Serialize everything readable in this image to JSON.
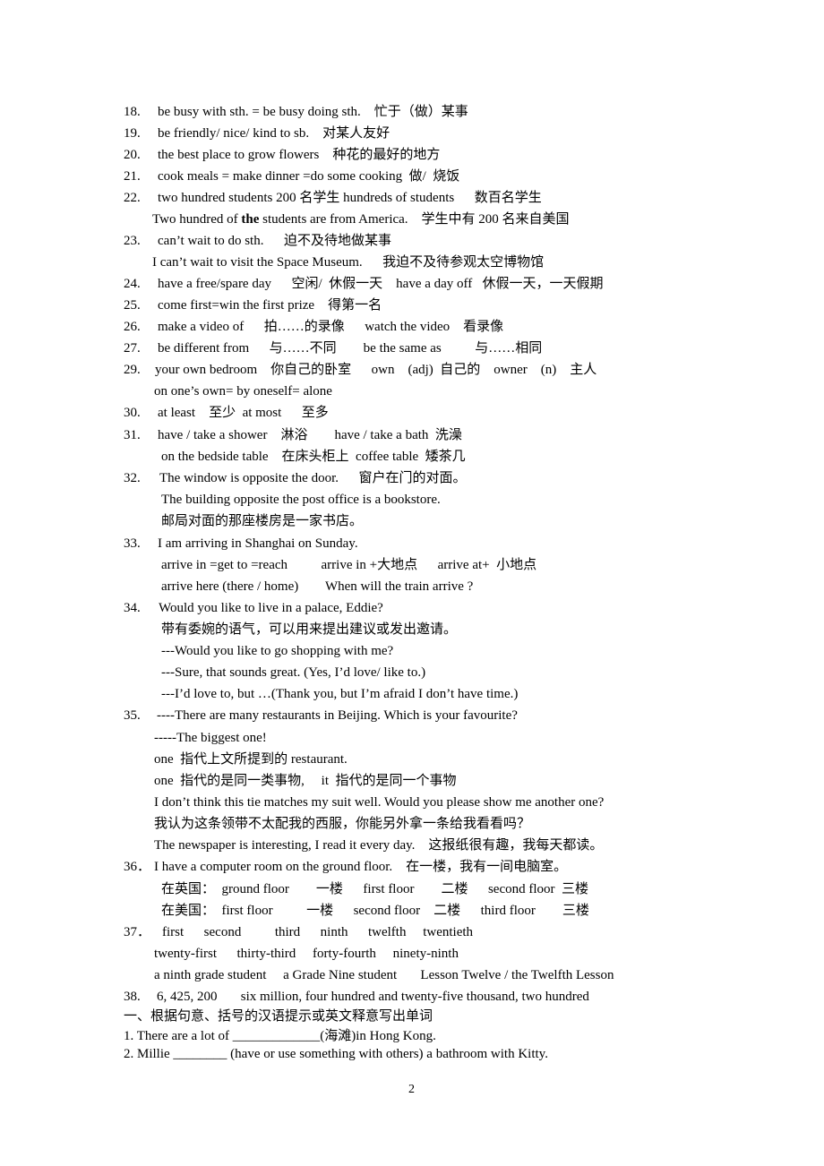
{
  "lines": [
    {
      "num": "18.",
      "text": "be busy with sth. = be busy doing sth.    忙于（做）某事"
    },
    {
      "num": "19.",
      "text": "be friendly/ nice/ kind to sb.    对某人友好"
    },
    {
      "num": "20.",
      "text": "the best place to grow flowers    种花的最好的地方"
    },
    {
      "num": "21.",
      "text": "cook meals = make dinner =do some cooking  做/  烧饭"
    },
    {
      "num": "22.",
      "text": "two hundred students 200 名学生 hundreds of students      数百名学生"
    },
    {
      "num": "",
      "pre": "Two hundred of ",
      "bold": "the",
      "post": " students are from America.    学生中有 200 名来自美国"
    },
    {
      "num": "23.",
      "text": "can’t wait to do sth.      迫不及待地做某事"
    },
    {
      "num": "",
      "text": "I can’t wait to visit the Space Museum.      我迫不及待参观太空博物馆"
    },
    {
      "num": "24.",
      "text": "have a free/spare day      空闲/  休假一天    have a day off   休假一天，一天假期"
    },
    {
      "num": "25.",
      "text": "come first=win the first prize    得第一名"
    },
    {
      "num": "26.",
      "text": "make a video of      拍……的录像      watch the video    看录像"
    },
    {
      "num": "27.",
      "text": "be different from      与……不同        be the same as          与……相同"
    },
    {
      "num": "29.",
      "text": "your own bedroom    你自己的卧室      own    (adj)  自己的    owner    (n)    主人"
    },
    {
      "num": "",
      "text": "on one’s own= by oneself= alone"
    },
    {
      "num": "30.",
      "text": "at least    至少  at most      至多"
    },
    {
      "num": "31.",
      "text": "have / take a shower    淋浴        have / take a bath  洗澡"
    },
    {
      "num": "",
      "text": "on the bedside table    在床头柜上  coffee table  矮茶几"
    },
    {
      "num": "32.",
      "text": "The window is opposite the door.      窗户在门的对面。"
    },
    {
      "num": "",
      "text": "The building opposite the post office is a bookstore."
    },
    {
      "num": "",
      "text": "邮局对面的那座楼房是一家书店。"
    },
    {
      "num": "33.",
      "text": "I am arriving in Shanghai on Sunday."
    },
    {
      "num": "",
      "text": "arrive in =get to =reach          arrive in +大地点      arrive at+  小地点"
    },
    {
      "num": "",
      "text": "arrive here (there / home)        When will the train arrive ?"
    },
    {
      "num": "34.",
      "text": "Would you like to live in a palace, Eddie?"
    },
    {
      "num": "",
      "text": "带有委婉的语气，可以用来提出建议或发出邀请。"
    },
    {
      "num": "",
      "text": "---Would you like to go shopping with me?"
    },
    {
      "num": "",
      "text": "---Sure, that sounds great. (Yes, I’d love/ like to.)"
    },
    {
      "num": "",
      "text": "---I’d love to, but …(Thank you, but I’m afraid I don’t have time.)"
    },
    {
      "num": "35.",
      "text": "----There are many restaurants in Beijing. Which is your favourite?"
    },
    {
      "num": "",
      "text": "-----The biggest one!"
    },
    {
      "num": "",
      "text": "one  指代上文所提到的 restaurant."
    },
    {
      "num": "",
      "text": "one  指代的是同一类事物,     it  指代的是同一个事物"
    },
    {
      "num": "",
      "text": "I don’t think this tie matches my suit well. Would you please show me another one?"
    },
    {
      "num": "",
      "text": "我认为这条领带不太配我的西服，你能另外拿一条给我看看吗？"
    },
    {
      "num": "",
      "text": "The newspaper is interesting, I read it every day.    这报纸很有趣，我每天都读。"
    },
    {
      "num": "36．",
      "text": "I have a computer room on the ground floor.    在一楼，我有一间电脑室。"
    },
    {
      "num": "",
      "text": "在英国：  ground floor        一楼      first floor        二楼      second floor  三楼"
    },
    {
      "num": "",
      "text": "在美国：  first floor          一楼      second floor    二楼      third floor        三楼"
    },
    {
      "num": "37．",
      "text": "first      second          third      ninth      twelfth     twentieth"
    },
    {
      "num": "",
      "text": "twenty-first      thirty-third     forty-fourth     ninety-ninth"
    },
    {
      "num": "",
      "text": "a ninth grade student     a Grade Nine student       Lesson Twelve / the Twelfth Lesson"
    },
    {
      "num": "38.",
      "text": "6, 425, 200       six million, four hundred and twenty-five thousand, two hundred"
    },
    {
      "num": "",
      "text": "一、根据句意、括号的汉语提示或英文释意写出单词"
    },
    {
      "num": "",
      "text": "1. There are a lot of _____________(海滩)in Hong Kong."
    },
    {
      "num": "",
      "text": "2. Millie ________ (have or use something with others) a bathroom with Kitty."
    }
  ],
  "page_number": "2"
}
